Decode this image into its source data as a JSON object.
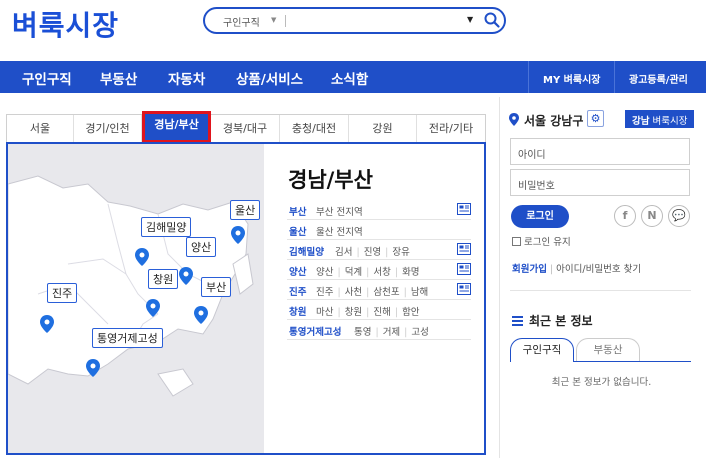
{
  "logo": "벼룩시장",
  "search": {
    "category": "구인구직",
    "placeholder": ""
  },
  "nav": {
    "items": [
      "구인구직",
      "부동산",
      "자동차",
      "상품/서비스",
      "소식함"
    ],
    "right": [
      "MY 벼룩시장",
      "광고등록/관리"
    ]
  },
  "region_tabs": [
    "서울",
    "경기/인천",
    "경남/부산",
    "경북/대구",
    "충청/대전",
    "강원",
    "전라/기타"
  ],
  "active_tab": "경남/부산",
  "panel": {
    "title": "경남/부산",
    "map_labels": [
      "울산",
      "김해밀양",
      "양산",
      "창원",
      "부산",
      "진주",
      "통영거제고성"
    ],
    "rows": [
      {
        "name": "부산",
        "subs": [
          "부산 전지역"
        ],
        "book": true
      },
      {
        "name": "울산",
        "subs": [
          "울산 전지역"
        ],
        "book": false
      },
      {
        "name": "김해밀양",
        "subs": [
          "김서",
          "진영",
          "장유"
        ],
        "book": true
      },
      {
        "name": "양산",
        "subs": [
          "양산",
          "덕계",
          "서창",
          "화명"
        ],
        "book": true
      },
      {
        "name": "진주",
        "subs": [
          "진주",
          "사천",
          "삼천포",
          "남해"
        ],
        "book": true
      },
      {
        "name": "창원",
        "subs": [
          "마산",
          "창원",
          "진해",
          "함안"
        ],
        "book": false
      },
      {
        "name": "통영거제고성",
        "subs": [
          "통영",
          "거제",
          "고성"
        ],
        "book": false
      }
    ]
  },
  "sidebar": {
    "location": "서울 강남구",
    "location_btn_bold": "강남",
    "location_btn_rest": " 벼룩시장",
    "id_placeholder": "아이디",
    "pw_placeholder": "비밀번호",
    "login": "로그인",
    "social": [
      "f",
      "N",
      "💬"
    ],
    "keep_login": "로그인 유지",
    "join": "회원가입",
    "find": "아이디/비밀번호 찾기",
    "recent_title": "최근 본 정보",
    "recent_tabs": [
      "구인구직",
      "부동산"
    ],
    "recent_empty": "최근 본 정보가 없습니다."
  },
  "colors": {
    "brand": "#1f4fc8",
    "active_border": "#e0141d",
    "map_bg": "#e8e8ec"
  }
}
